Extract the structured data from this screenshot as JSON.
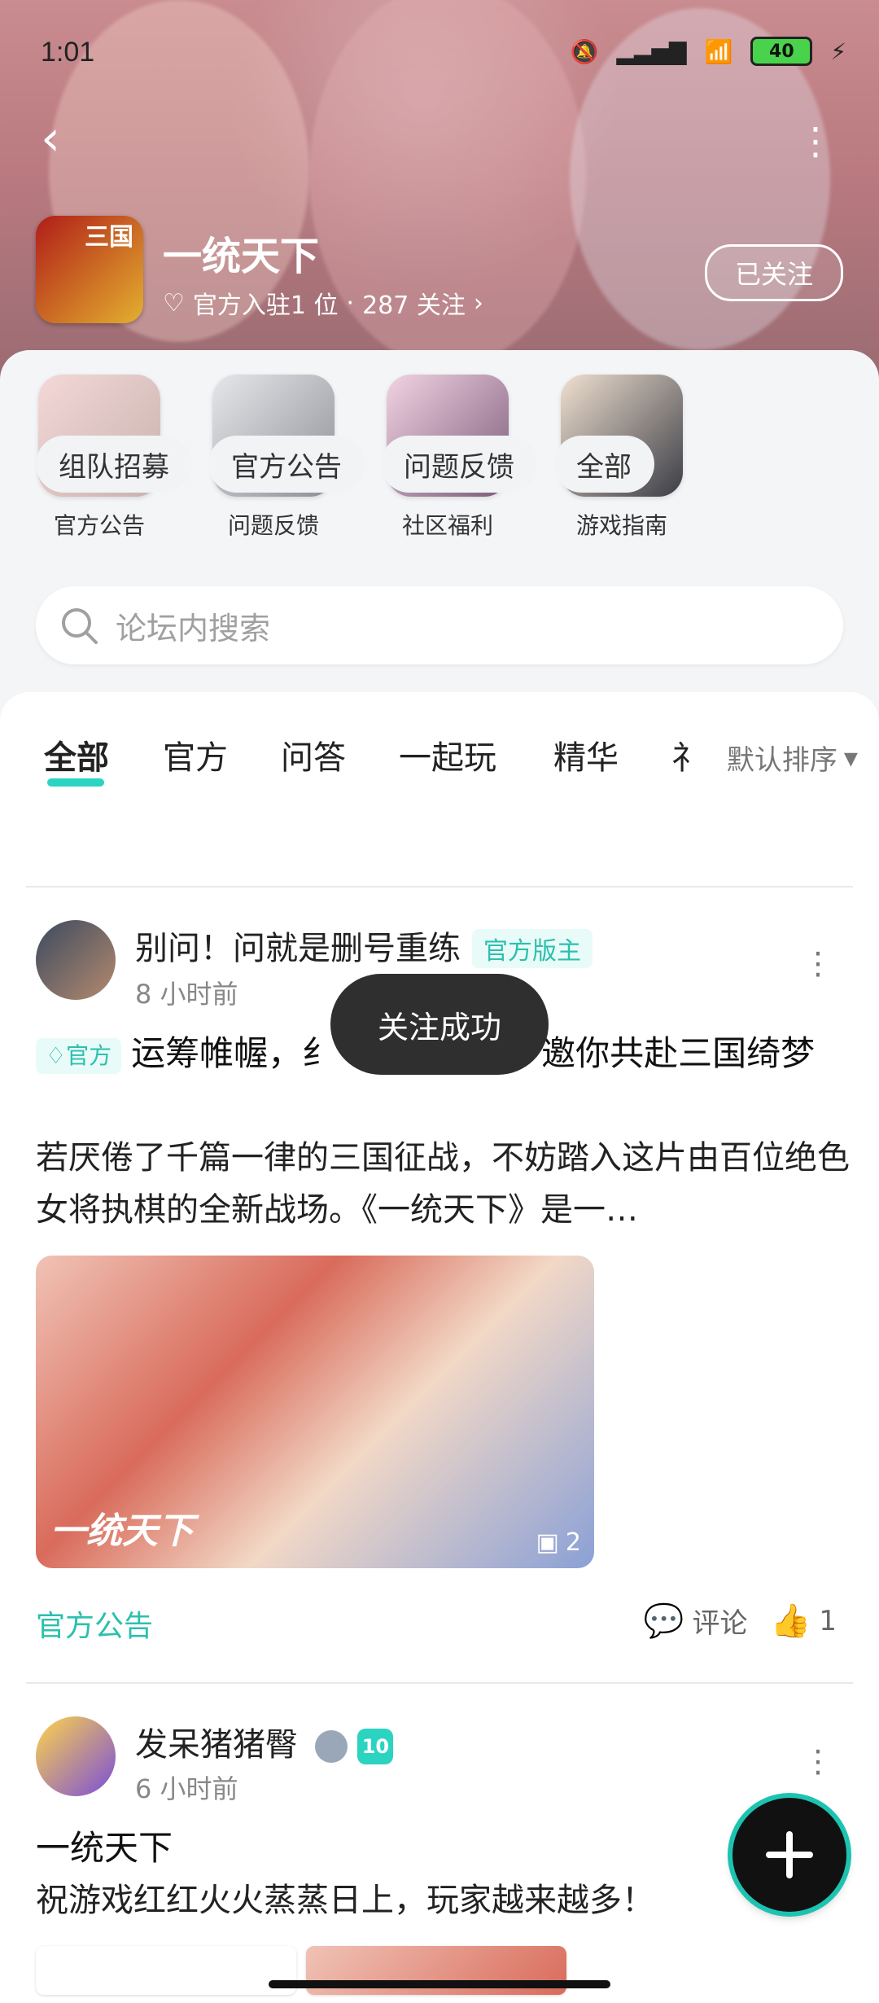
{
  "status_bar": {
    "time": "1:01",
    "battery": "40"
  },
  "header": {
    "game_title": "一统天下",
    "meta_official": "官方入驻1 位",
    "meta_followers": "287 关注",
    "follow_button": "已关注",
    "game_icon_text": "三国"
  },
  "quick_links": [
    {
      "label": "官方公告"
    },
    {
      "label": "问题反馈"
    },
    {
      "label": "社区福利"
    },
    {
      "label": "游戏指南"
    }
  ],
  "search": {
    "placeholder": "论坛内搜索"
  },
  "tabs": [
    {
      "label": "全部"
    },
    {
      "label": "官方"
    },
    {
      "label": "问答"
    },
    {
      "label": "一起玩"
    },
    {
      "label": "精华"
    },
    {
      "label": "礻"
    }
  ],
  "sort": {
    "label": "默认排序"
  },
  "chips": [
    {
      "label": "组队招募"
    },
    {
      "label": "官方公告"
    },
    {
      "label": "问题反馈"
    },
    {
      "label": "全部"
    }
  ],
  "posts": [
    {
      "author": "别问！问就是删号重练",
      "role": "官方版主",
      "time": "8 小时前",
      "tag": "官方",
      "title": "运筹帷幄，纟《一统天下》邀你共赴三国绮梦",
      "body": "若厌倦了千篇一律的三国征战，不妨踏入这片由百位绝色女将执棋的全新战场。《一统天下》是一…",
      "image_overlay": "一统天下",
      "image_count": "2",
      "category": "官方公告",
      "comment_label": "评论",
      "like_count": "1"
    },
    {
      "author": "发呆猪猪臀",
      "level": "10",
      "time": "6 小时前",
      "title": "一统天下",
      "body": "祝游戏红红火火蒸蒸日上，玩家越来越多！"
    }
  ],
  "toast": "关注成功"
}
